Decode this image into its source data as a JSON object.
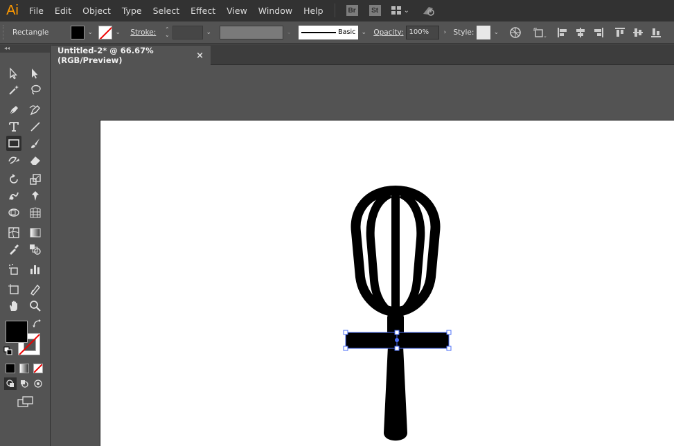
{
  "app": {
    "logo_text": "Ai"
  },
  "menu": [
    "File",
    "Edit",
    "Object",
    "Type",
    "Select",
    "Effect",
    "View",
    "Window",
    "Help"
  ],
  "menubar_buttons": {
    "bridge": "Br",
    "stock": "St"
  },
  "control_bar": {
    "tool_name": "Rectangle",
    "stroke_label": "Stroke:",
    "stroke_style": "Basic",
    "opacity_label": "Opacity:",
    "opacity_value": "100%",
    "style_label": "Style:"
  },
  "document": {
    "tab_title": "Untitled-2* @ 66.67% (RGB/Preview)",
    "close_glyph": "×"
  },
  "colors": {
    "accent_orange": "#ff9a00",
    "selection_blue": "#4a6cf7",
    "fill": "#000000"
  },
  "icons": [
    "selection-icon",
    "direct-selection-icon",
    "magic-wand-icon",
    "lasso-icon",
    "pen-icon",
    "curvature-icon",
    "type-icon",
    "line-segment-icon",
    "rectangle-icon",
    "paintbrush-icon",
    "shaper-icon",
    "eraser-icon",
    "rotate-icon",
    "scale-icon",
    "warp-icon",
    "puppet-warp-icon",
    "free-transform-icon",
    "perspective-grid-icon",
    "mesh-icon",
    "gradient-icon",
    "eyedropper-icon",
    "blend-icon",
    "symbol-sprayer-icon",
    "column-graph-icon",
    "artboard-icon",
    "slice-icon",
    "hand-icon",
    "zoom-icon"
  ]
}
